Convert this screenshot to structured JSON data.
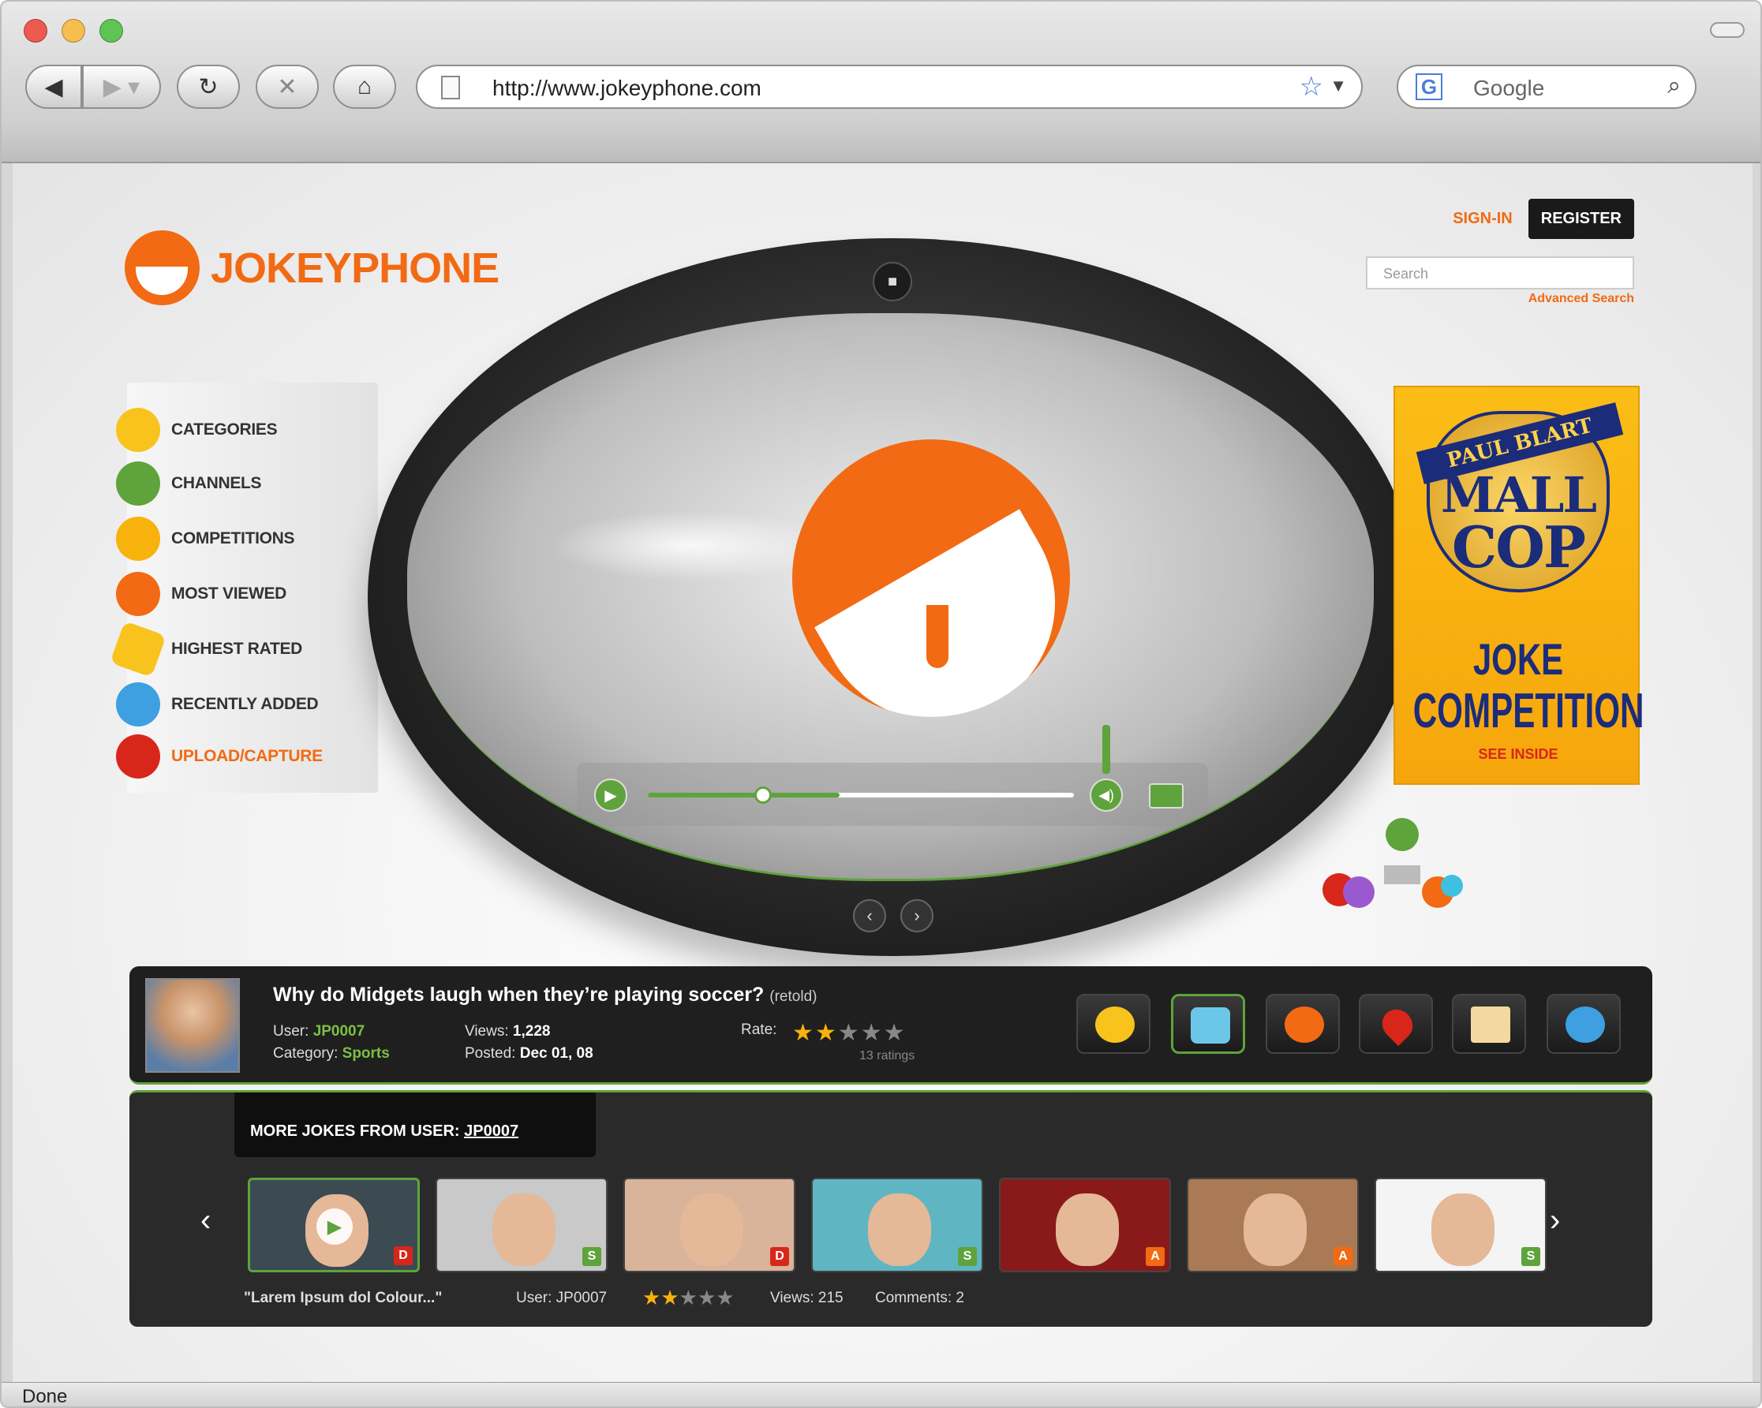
{
  "browser": {
    "url": "http://www.jokeyphone.com",
    "search_placeholder": "Google",
    "status": "Done",
    "icons": [
      "back-icon",
      "forward-icon",
      "reload-icon",
      "stop-icon",
      "home-icon",
      "bookmark-star-icon",
      "google-icon",
      "search-icon"
    ]
  },
  "header": {
    "logo": "JOKEYPHONE",
    "sign_in": "SIGN-IN",
    "register": "REGISTER",
    "search_placeholder": "Search",
    "advanced_search": "Advanced Search"
  },
  "menu": {
    "items": [
      {
        "label": "CATEGORIES",
        "icon": "categories-icon",
        "color": "#f8c31c"
      },
      {
        "label": "CHANNELS",
        "icon": "channels-icon",
        "color": "#5ea33b"
      },
      {
        "label": "COMPETITIONS",
        "icon": "trophy-icon",
        "color": "#f8b20c"
      },
      {
        "label": "MOST VIEWED",
        "icon": "eyes-icon",
        "color": "#f26a13"
      },
      {
        "label": "HIGHEST RATED",
        "icon": "star-icon",
        "color": "#f8c31c"
      },
      {
        "label": "RECENTLY ADDED",
        "icon": "plus-icon",
        "color": "#3ea0e0"
      },
      {
        "label": "UPLOAD/CAPTURE",
        "icon": "upload-icon",
        "color": "#d8261b",
        "highlight": true
      }
    ]
  },
  "player": {
    "progress": 0.25,
    "buffered": 0.45,
    "icons": [
      "camera-icon",
      "play-icon",
      "volume-icon",
      "fullscreen-icon",
      "prev-icon",
      "next-icon"
    ]
  },
  "ad": {
    "line1": "PAUL BLART",
    "line2": "MALL",
    "line3": "COP",
    "line4": "JOKE",
    "line5": "COMPETITION",
    "line6": "SEE INSIDE"
  },
  "joke": {
    "title": "Why do Midgets laugh when they’re playing soccer?",
    "title_suffix": "(retold)",
    "user_label": "User:",
    "user": "JP0007",
    "category_label": "Category:",
    "category": "Sports",
    "views_label": "Views:",
    "views": "1,228",
    "posted_label": "Posted:",
    "posted": "Dec 01, 08",
    "rate_label": "Rate:",
    "rating": 2,
    "rating_max": 5,
    "ratings_count": "13 ratings",
    "tools": [
      {
        "icon": "share-icon",
        "active": false
      },
      {
        "icon": "tv-icon",
        "active": true
      },
      {
        "icon": "comment-icon",
        "active": false
      },
      {
        "icon": "favorite-add-icon",
        "active": false
      },
      {
        "icon": "send-icon",
        "active": false
      },
      {
        "icon": "friends-icon",
        "active": false
      }
    ]
  },
  "more": {
    "title": "MORE JOKES FROM USER:",
    "title_user": "JP0007",
    "thumbnails": [
      {
        "badge": "D",
        "badge_color": "#d8261b",
        "bg": "#3c4a52",
        "active": true
      },
      {
        "badge": "S",
        "badge_color": "#5ea33b",
        "bg": "#c9c9c9",
        "active": false
      },
      {
        "badge": "D",
        "badge_color": "#d8261b",
        "bg": "#d9b49a",
        "active": false
      },
      {
        "badge": "S",
        "badge_color": "#5ea33b",
        "bg": "#5fb6c2",
        "active": false
      },
      {
        "badge": "A",
        "badge_color": "#f26a13",
        "bg": "#8a1a1a",
        "active": false
      },
      {
        "badge": "A",
        "badge_color": "#f26a13",
        "bg": "#a97a55",
        "active": false
      },
      {
        "badge": "S",
        "badge_color": "#5ea33b",
        "bg": "#f4f4f4",
        "active": false
      }
    ],
    "selected_title": "\"Larem Ipsum dol Colour...\"",
    "selected_user": "User: JP0007",
    "selected_rating": 2,
    "selected_views": "Views: 215",
    "selected_comments": "Comments: 2"
  },
  "colors": {
    "accent": "#f26a13",
    "green": "#5ea33b",
    "dark": "#1f1f1f"
  }
}
